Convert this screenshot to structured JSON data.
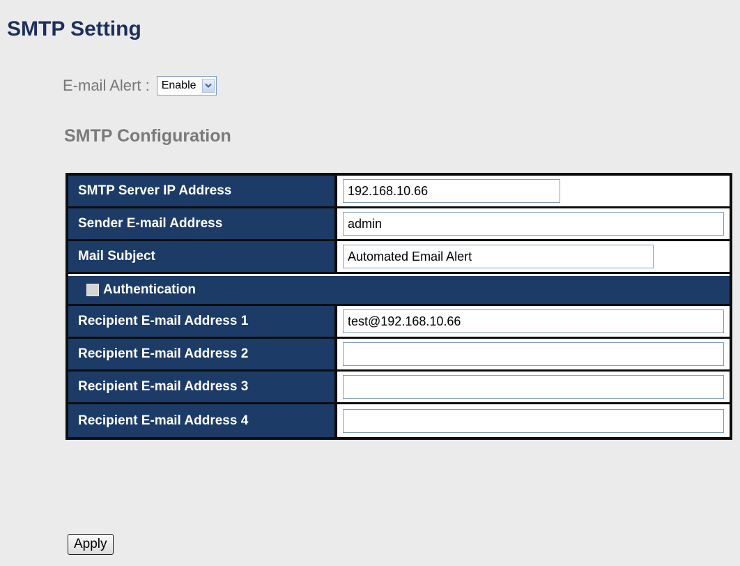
{
  "page": {
    "title": "SMTP Setting"
  },
  "email_alert": {
    "label": "E-mail Alert :",
    "selected": "Enable"
  },
  "section": {
    "title": "SMTP Configuration"
  },
  "fields": {
    "smtp_server": {
      "label": "SMTP Server IP Address",
      "value": "192.168.10.66"
    },
    "sender": {
      "label": "Sender E-mail Address",
      "value": "admin"
    },
    "subject": {
      "label": "Mail Subject",
      "value": "Automated Email Alert"
    },
    "authentication": {
      "label": "Authentication",
      "checked": false
    },
    "recipient_1": {
      "label": "Recipient E-mail Address 1",
      "value": "test@192.168.10.66"
    },
    "recipient_2": {
      "label": "Recipient E-mail Address 2",
      "value": ""
    },
    "recipient_3": {
      "label": "Recipient E-mail Address 3",
      "value": ""
    },
    "recipient_4": {
      "label": "Recipient E-mail Address 4",
      "value": ""
    }
  },
  "actions": {
    "apply_label": "Apply"
  },
  "colors": {
    "header_text": "#1b2f5c",
    "label_background": "#1c3b67",
    "page_background": "#ebebeb"
  },
  "icons": {
    "select_arrow": "chevron-down-icon"
  }
}
